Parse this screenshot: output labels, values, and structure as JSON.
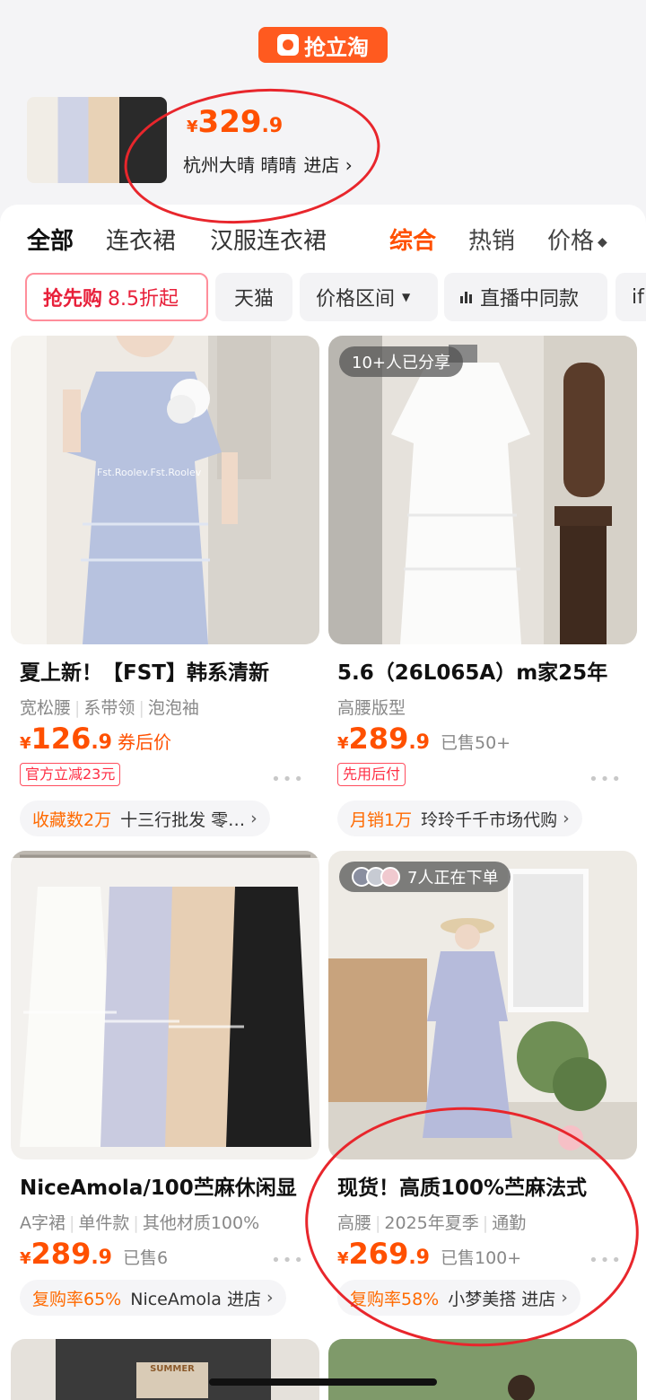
{
  "header": {
    "logo_text": "抢立淘"
  },
  "shop_banner": {
    "price_yen": "¥",
    "price_int": "329",
    "price_dec": ".9",
    "shop_name": "杭州大晴 晴晴",
    "enter_label": "进店 ›"
  },
  "tabs": [
    "全部",
    "连衣裙",
    "汉服连衣裙"
  ],
  "sort": {
    "composite": "综合",
    "hot": "热销",
    "price": "价格"
  },
  "filters": {
    "promo_main": "抢先购",
    "promo_sub": "8.5折起",
    "tmall": "天猫",
    "price_range": "价格区间",
    "live_same": "直播中同款",
    "more": "if"
  },
  "products": [
    {
      "title": "夏上新！【FST】韩系清新",
      "tags": [
        "宽松腰",
        "系带领",
        "泡泡袖"
      ],
      "price_int": "126",
      "price_dec": ".9",
      "price_note": "券后价",
      "sold": "",
      "badge": "官方立减23元",
      "shop_stat": "收藏数2万",
      "shop_name": "十三行批发 零…",
      "image_overlay": "",
      "image_watermark": "Fst.Roolev.Fst.Roolev"
    },
    {
      "title": "5.6（26L065A）m家25年",
      "tags": [
        "高腰版型"
      ],
      "price_int": "289",
      "price_dec": ".9",
      "price_note": "",
      "sold": "已售50+",
      "badge": "先用后付",
      "shop_stat": "月销1万",
      "shop_name": "玲玲千千市场代购",
      "image_overlay": "10+人已分享"
    },
    {
      "title": "NiceAmola/100苎麻休闲显",
      "tags": [
        "A字裙",
        "单件款",
        "其他材质100%"
      ],
      "price_int": "289",
      "price_dec": ".9",
      "price_note": "",
      "sold": "已售6",
      "badge": "",
      "shop_stat": "复购率65%",
      "shop_name": "NiceAmola 进店",
      "image_overlay": ""
    },
    {
      "title": "现货！高质100%苎麻法式",
      "tags": [
        "高腰",
        "2025年夏季",
        "通勤"
      ],
      "price_int": "269",
      "price_dec": ".9",
      "price_note": "",
      "sold": "已售100+",
      "badge": "",
      "shop_stat": "复购率58%",
      "shop_name": "小梦美搭 进店",
      "image_overlay": "7人正在下单"
    }
  ],
  "peek_card_text": "SUMMER",
  "colors": {
    "accent": "#ff5000",
    "promo_red": "#e8203a",
    "annotation": "#e8262c"
  }
}
